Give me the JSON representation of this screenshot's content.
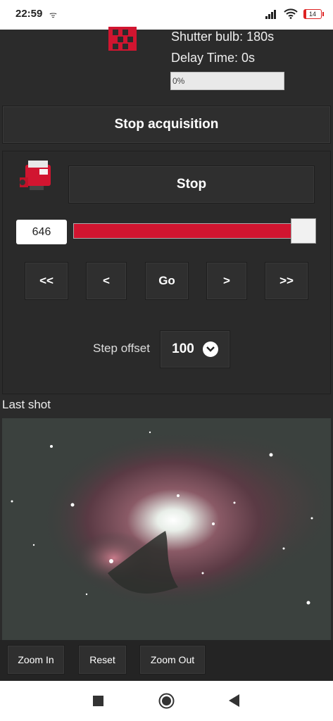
{
  "status_bar": {
    "time": "22:59",
    "sub_icon": "ᯤ",
    "battery": "14"
  },
  "acquisition": {
    "shutter": "Shutter bulb: 180s",
    "delay": "Delay Time: 0s",
    "progress_text": "0%",
    "progress_value": 0,
    "stop_acquisition_label": "Stop acquisition"
  },
  "focuser": {
    "stop_label": "Stop",
    "position_value": "646",
    "slider_level": 1.0,
    "slider_color": "#d11530",
    "nav": [
      "<<",
      "<",
      "Go",
      ">",
      ">>"
    ],
    "step_offset_label": "Step offset",
    "step_offset_value": "100"
  },
  "last_shot": {
    "title": "Last shot",
    "zoom_in_label": "Zoom In",
    "reset_label": "Reset",
    "zoom_out_label": "Zoom Out"
  },
  "icons": [
    "signal-icon",
    "wifi-icon",
    "battery-icon",
    "stop-square-icon",
    "home-circle-icon",
    "back-triangle-icon",
    "chevron-down-icon",
    "camera-icon",
    "app-logo-icon"
  ]
}
